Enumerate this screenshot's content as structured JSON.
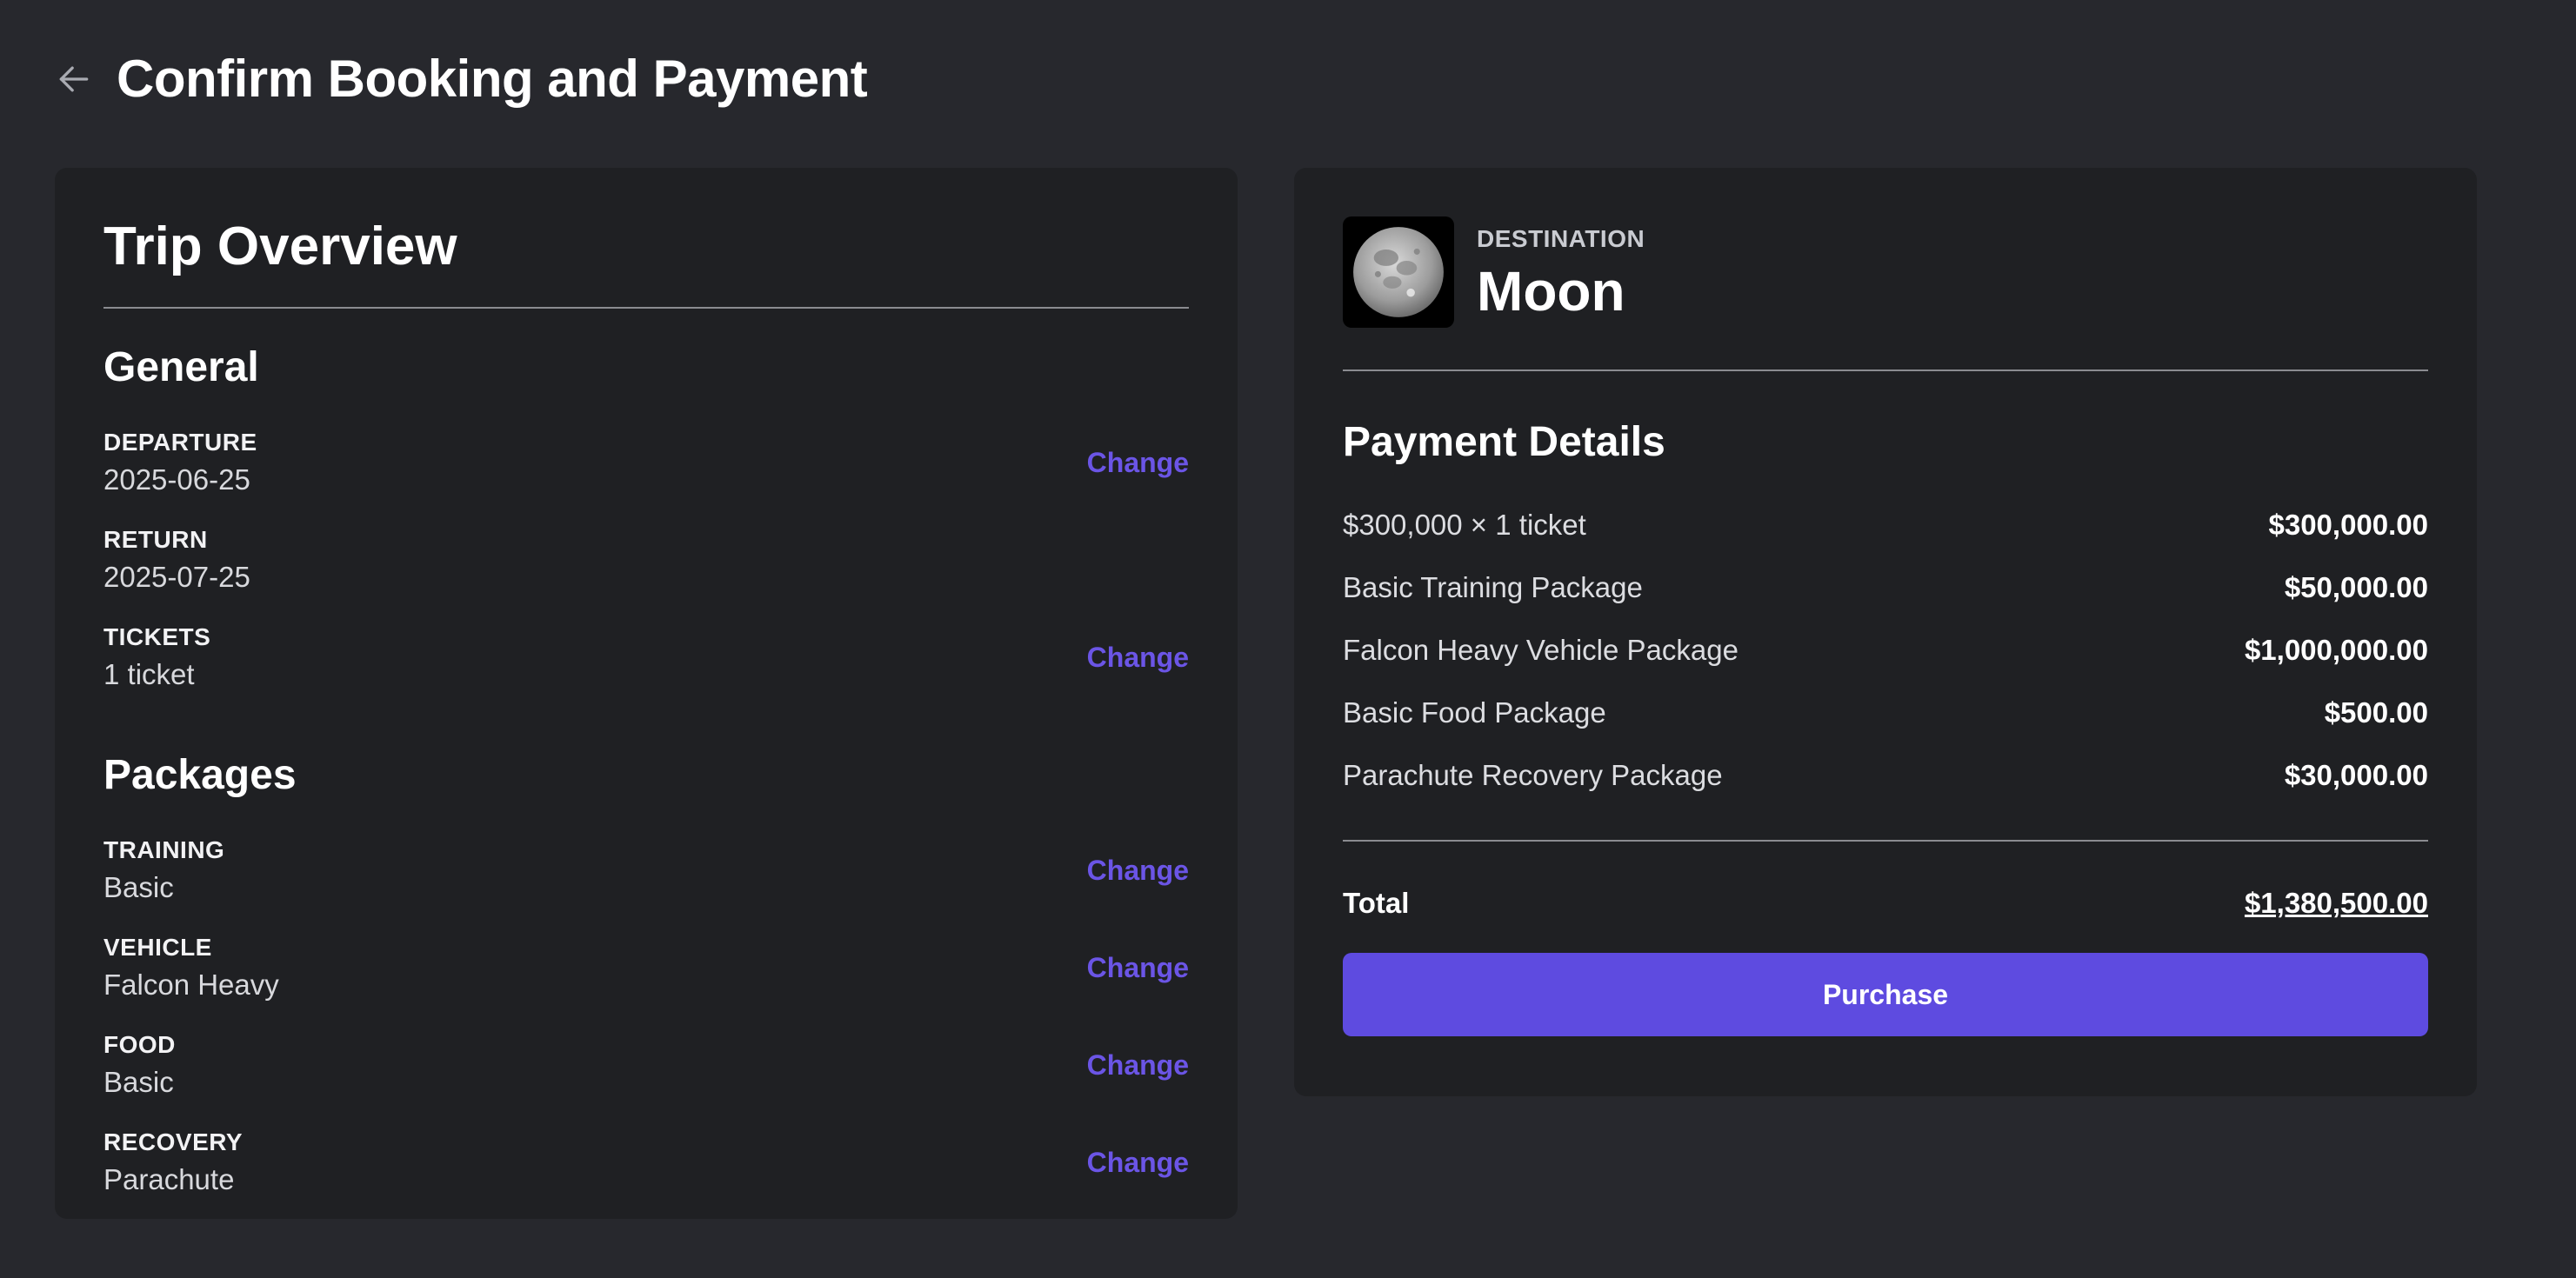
{
  "header": {
    "title": "Confirm Booking and Payment",
    "back_icon": "arrow-left-icon"
  },
  "trip_overview": {
    "title": "Trip Overview",
    "general": {
      "title": "General",
      "items": [
        {
          "label": "DEPARTURE",
          "value": "2025-06-25",
          "action": "Change"
        },
        {
          "label": "RETURN",
          "value": "2025-07-25",
          "action": ""
        },
        {
          "label": "TICKETS",
          "value": "1 ticket",
          "action": "Change"
        }
      ]
    },
    "packages": {
      "title": "Packages",
      "items": [
        {
          "label": "TRAINING",
          "value": "Basic",
          "action": "Change"
        },
        {
          "label": "VEHICLE",
          "value": "Falcon Heavy",
          "action": "Change"
        },
        {
          "label": "FOOD",
          "value": "Basic",
          "action": "Change"
        },
        {
          "label": "RECOVERY",
          "value": "Parachute",
          "action": "Change"
        }
      ]
    }
  },
  "destination": {
    "label": "DESTINATION",
    "name": "Moon",
    "image": "moon-image"
  },
  "payment": {
    "title": "Payment Details",
    "items": [
      {
        "label": "$300,000 × 1 ticket",
        "amount": "$300,000.00"
      },
      {
        "label": "Basic Training Package",
        "amount": "$50,000.00"
      },
      {
        "label": "Falcon Heavy Vehicle Package",
        "amount": "$1,000,000.00"
      },
      {
        "label": "Basic Food Package",
        "amount": "$500.00"
      },
      {
        "label": "Parachute Recovery Package",
        "amount": "$30,000.00"
      }
    ],
    "total_label": "Total",
    "total_amount": "$1,380,500.00",
    "purchase_label": "Purchase"
  },
  "colors": {
    "background": "#27282d",
    "card": "#1f2023",
    "accent": "#5e4be0",
    "link": "#6b55e6"
  }
}
